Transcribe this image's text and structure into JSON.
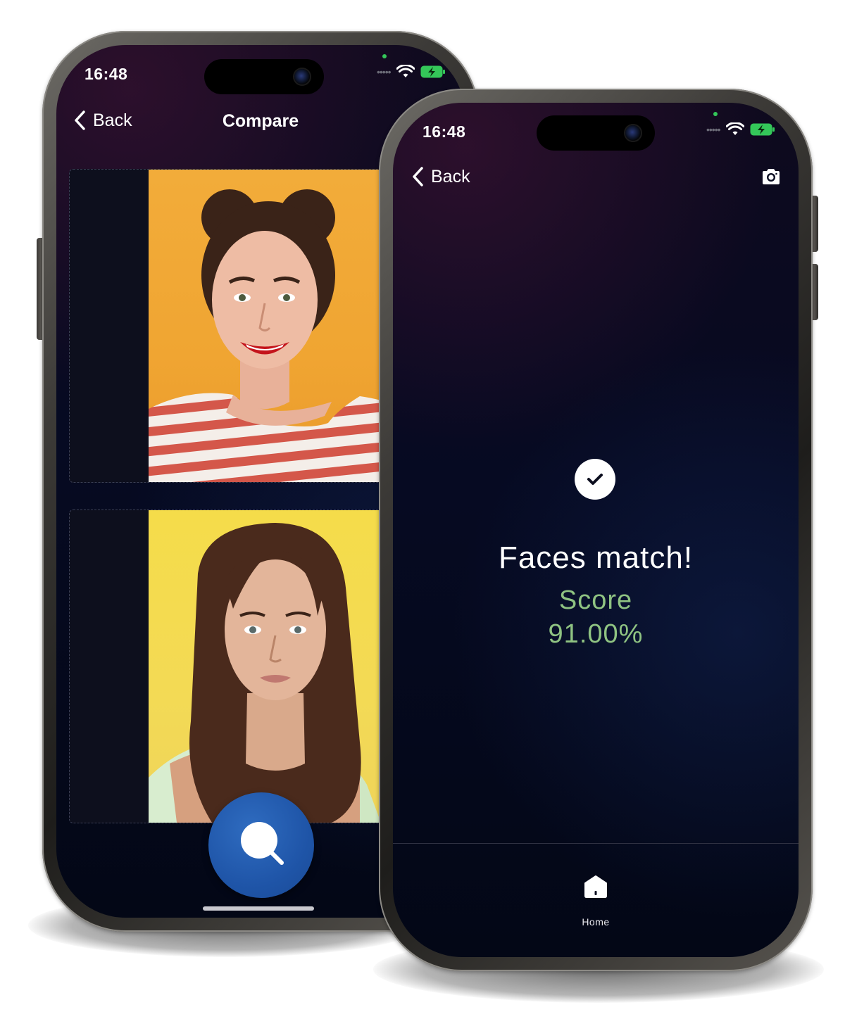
{
  "phone_left": {
    "status_bar": {
      "time": "16:48"
    },
    "nav": {
      "back_label": "Back",
      "title": "Compare"
    },
    "photos": [
      {
        "name": "woman-with-buns-yellow-orange-background"
      },
      {
        "name": "woman-long-hair-yellow-background"
      }
    ],
    "actions": {
      "search_icon": "search-icon"
    }
  },
  "phone_right": {
    "status_bar": {
      "time": "16:48"
    },
    "nav": {
      "back_label": "Back",
      "camera_icon": "camera-icon"
    },
    "result": {
      "title": "Faces match!",
      "score_label": "Score",
      "score_value": "91.00%",
      "icon": "check-icon"
    },
    "tab_bar": {
      "items": [
        {
          "label": "Home",
          "icon": "home-icon"
        }
      ]
    }
  },
  "colors": {
    "accent_blue": "#1f55a8",
    "score_green": "#8fc382",
    "background_dark": "#060a22"
  }
}
